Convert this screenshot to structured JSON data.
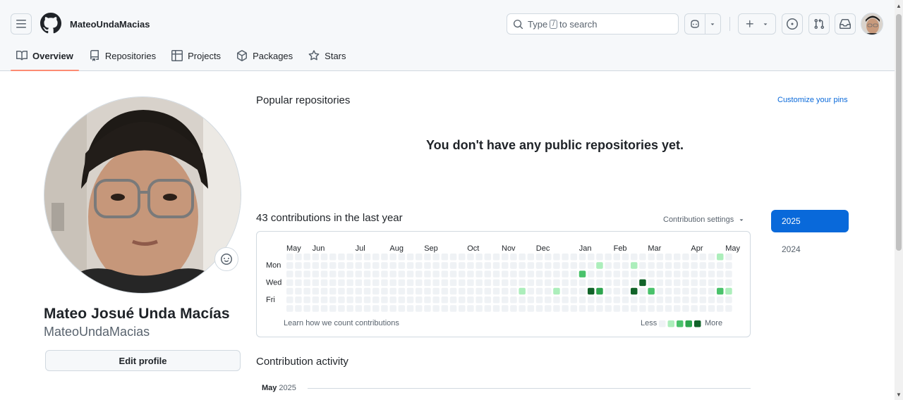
{
  "header": {
    "username": "MateoUndaMacias",
    "search_prefix": "Type",
    "search_key": "/",
    "search_suffix": "to search"
  },
  "tabs": [
    {
      "label": "Overview",
      "icon": "book-icon"
    },
    {
      "label": "Repositories",
      "icon": "repo-icon"
    },
    {
      "label": "Projects",
      "icon": "table-icon"
    },
    {
      "label": "Packages",
      "icon": "package-icon"
    },
    {
      "label": "Stars",
      "icon": "star-icon"
    }
  ],
  "profile": {
    "full_name": "Mateo Josué Unda Macías",
    "login": "MateoUndaMacias",
    "edit_label": "Edit profile"
  },
  "pinned": {
    "title": "Popular repositories",
    "customize_label": "Customize your pins",
    "empty_message": "You don't have any public repositories yet."
  },
  "contributions": {
    "summary": "43 contributions in the last year",
    "settings_label": "Contribution settings",
    "months": [
      "May",
      "Jun",
      "Jul",
      "Aug",
      "Sep",
      "Oct",
      "Nov",
      "Dec",
      "Jan",
      "Feb",
      "Mar",
      "Apr",
      "May"
    ],
    "day_labels": [
      "Mon",
      "Wed",
      "Fri"
    ],
    "learn_label": "Learn how we count contributions",
    "less_label": "Less",
    "more_label": "More",
    "level_colors": [
      "#eff2f5",
      "#aceebb",
      "#4ac26b",
      "#2da44e",
      "#116329"
    ],
    "weeks": 52,
    "active_cells": [
      {
        "week": 27,
        "day": 4,
        "level": 1
      },
      {
        "week": 31,
        "day": 4,
        "level": 1
      },
      {
        "week": 34,
        "day": 2,
        "level": 2
      },
      {
        "week": 35,
        "day": 4,
        "level": 4
      },
      {
        "week": 36,
        "day": 1,
        "level": 1
      },
      {
        "week": 36,
        "day": 4,
        "level": 3
      },
      {
        "week": 40,
        "day": 1,
        "level": 1
      },
      {
        "week": 40,
        "day": 4,
        "level": 4
      },
      {
        "week": 41,
        "day": 3,
        "level": 4
      },
      {
        "week": 42,
        "day": 4,
        "level": 2
      },
      {
        "week": 50,
        "day": 0,
        "level": 1
      },
      {
        "week": 50,
        "day": 4,
        "level": 2
      },
      {
        "week": 51,
        "day": 4,
        "level": 1
      }
    ]
  },
  "years": [
    "2025",
    "2024"
  ],
  "activity": {
    "title": "Contribution activity",
    "month": "May",
    "year": "2025"
  },
  "colors": {
    "accent": "#0969da",
    "tab_underline": "#fd8c73"
  }
}
